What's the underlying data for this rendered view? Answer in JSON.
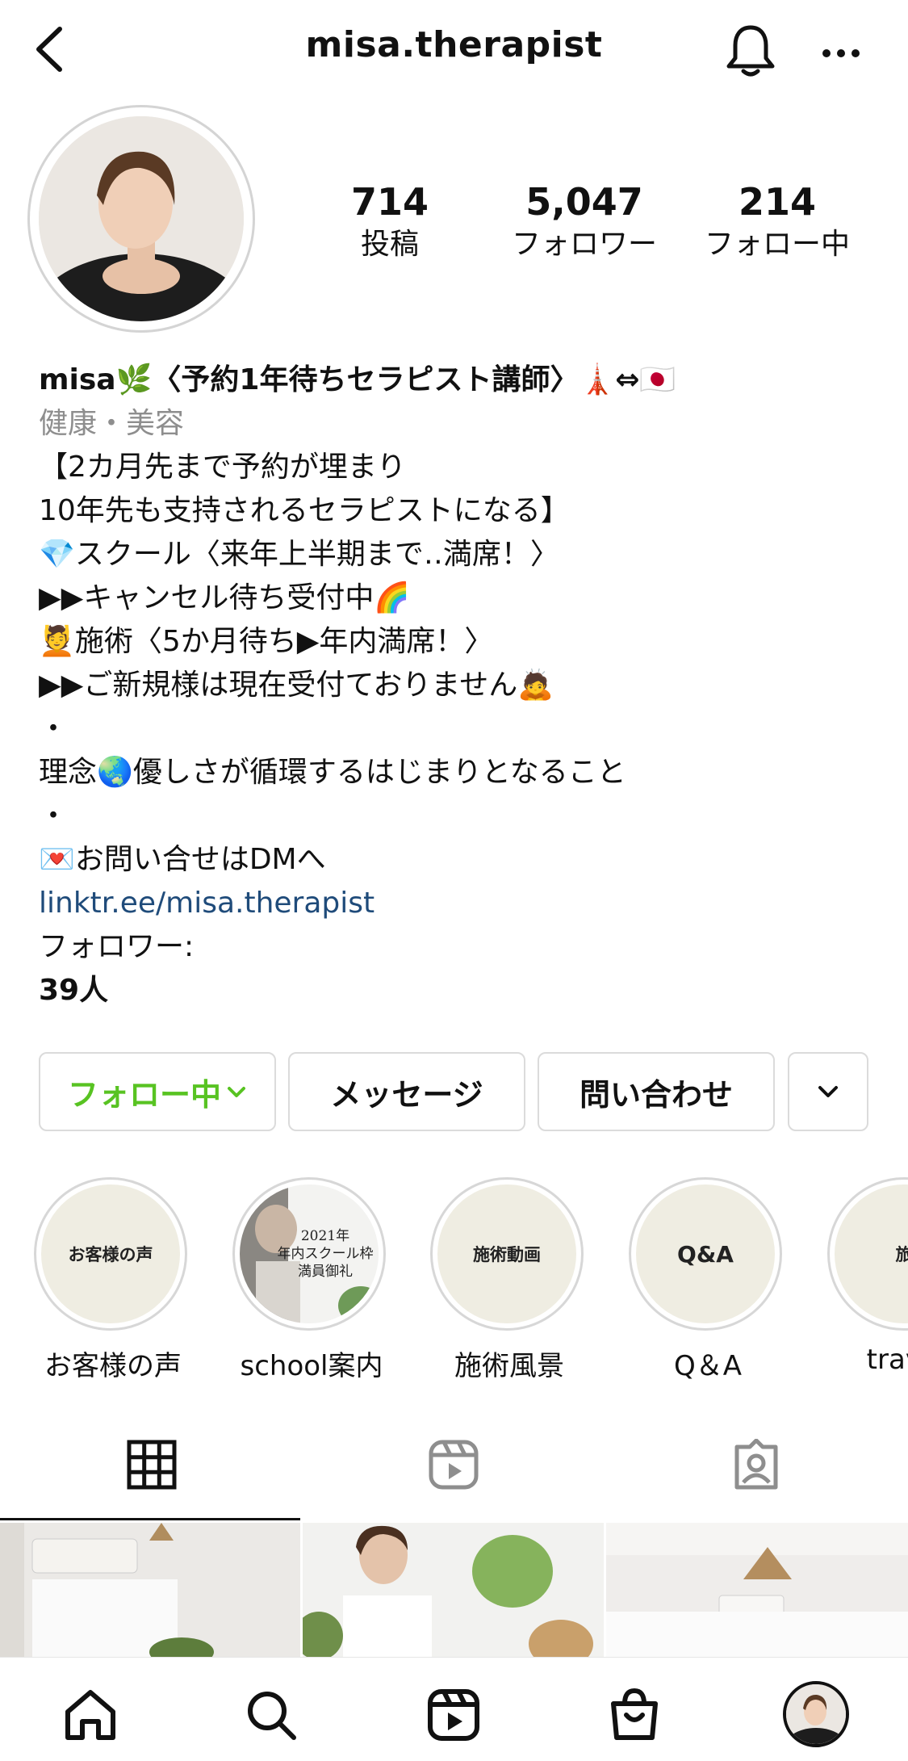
{
  "header": {
    "username": "misa.therapist"
  },
  "stats": [
    {
      "count": "714",
      "label": "投稿"
    },
    {
      "count": "5,047",
      "label": "フォロワー"
    },
    {
      "count": "214",
      "label": "フォロー中"
    }
  ],
  "bio": {
    "name": "misa🌿〈予約1年待ちセラピスト講師〉🗼⇔🇯🇵",
    "category": "健康・美容",
    "lines": [
      "【2カ月先まで予約が埋まり",
      "10年先も支持されるセラピストになる】",
      "💎スクール〈来年上半期まで‥満席！〉",
      "▶▶キャンセル待ち受付中🌈",
      "💆施術〈5か月待ち▶年内満席！〉",
      "▶▶ご新規様は現在受付ておりません🙇",
      "・",
      "理念🌏優しさが循環するはじまりとなること",
      "・",
      "💌お問い合せはDMへ"
    ],
    "link": "linktr.ee/misa.therapist",
    "followers_label": "フォロワー:",
    "followers_value": "39人"
  },
  "buttons": {
    "follow": "フォロー中",
    "message": "メッセージ",
    "contact": "問い合わせ"
  },
  "highlights": [
    {
      "cover_text": "お客様の声",
      "label": "お客様の声"
    },
    {
      "cover_text": "2021年\n年内スクール枠\n満員御礼",
      "label": "school案内"
    },
    {
      "cover_text": "施術動画",
      "label": "施術風景"
    },
    {
      "cover_text": "Q&A",
      "label": "Q＆A"
    },
    {
      "cover_text": "旅",
      "label": "travel"
    }
  ],
  "colors": {
    "accent": "#58c322",
    "link": "#1f4b7a",
    "muted": "#8e8e8e",
    "border": "#dbdbdb"
  },
  "icons": {
    "header": [
      "back-icon",
      "bell-icon",
      "more-icon"
    ],
    "tabs": [
      "grid-icon",
      "reels-icon",
      "tagged-icon"
    ],
    "nav": [
      "home-icon",
      "search-icon",
      "reels-icon",
      "shop-icon",
      "profile-avatar"
    ]
  }
}
